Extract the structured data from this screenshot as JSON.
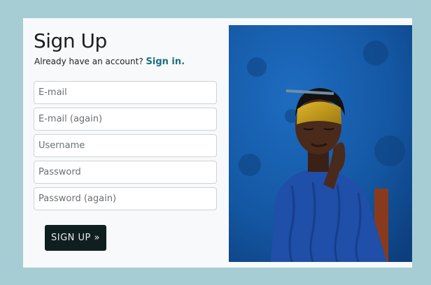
{
  "form": {
    "title": "Sign Up",
    "signin_prompt": "Already have an account?",
    "signin_link": "Sign in.",
    "email_placeholder": "E-mail",
    "email_again_placeholder": "E-mail (again)",
    "username_placeholder": "Username",
    "password_placeholder": "Password",
    "password_again_placeholder": "Password (again)",
    "submit_label": "SIGN UP »"
  },
  "colors": {
    "page_background": "#a7cdd4",
    "card_background": "#f7f9fa",
    "link": "#1b6f7c",
    "button": "#0f1f1f",
    "photo_wall": "#145ea8",
    "sweater": "#1f4fa8"
  }
}
